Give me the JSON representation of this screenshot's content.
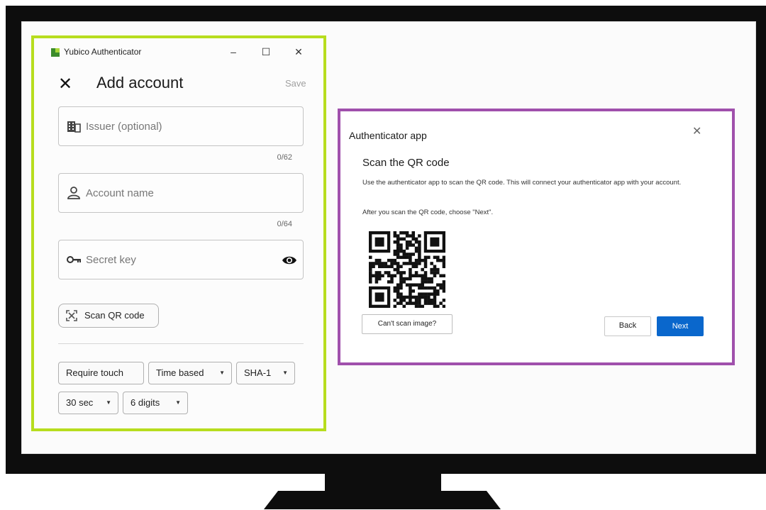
{
  "yubico": {
    "app_title": "Yubico Authenticator",
    "window_controls": {
      "minimize": "–",
      "maximize": "☐",
      "close": "✕"
    },
    "header": {
      "close_symbol": "✕",
      "title": "Add account",
      "save_label": "Save"
    },
    "fields": {
      "issuer": {
        "placeholder": "Issuer (optional)",
        "counter": "0/62",
        "icon": "building-icon"
      },
      "account": {
        "placeholder": "Account name",
        "counter": "0/64",
        "icon": "person-icon"
      },
      "secret": {
        "placeholder": "Secret key",
        "icon": "key-icon",
        "toggle_icon": "eye-icon"
      }
    },
    "scan_button": {
      "label": "Scan QR code",
      "icon": "qr-scan-icon"
    },
    "options": {
      "require_touch": "Require touch",
      "type": "Time based",
      "algorithm": "SHA-1",
      "period": "30 sec",
      "digits": "6 digits"
    },
    "accent_color": "#b7dd1e"
  },
  "auth_dialog": {
    "title": "Authenticator app",
    "close_symbol": "✕",
    "heading": "Scan the QR code",
    "description": "Use the authenticator app to scan the QR code. This will connect your authenticator app with your account.",
    "after_scan": "After you scan the QR code, choose \"Next\".",
    "cant_scan_label": "Can't scan image?",
    "back_label": "Back",
    "next_label": "Next",
    "accent_color": "#a050ac",
    "primary_color": "#0a67cc"
  }
}
